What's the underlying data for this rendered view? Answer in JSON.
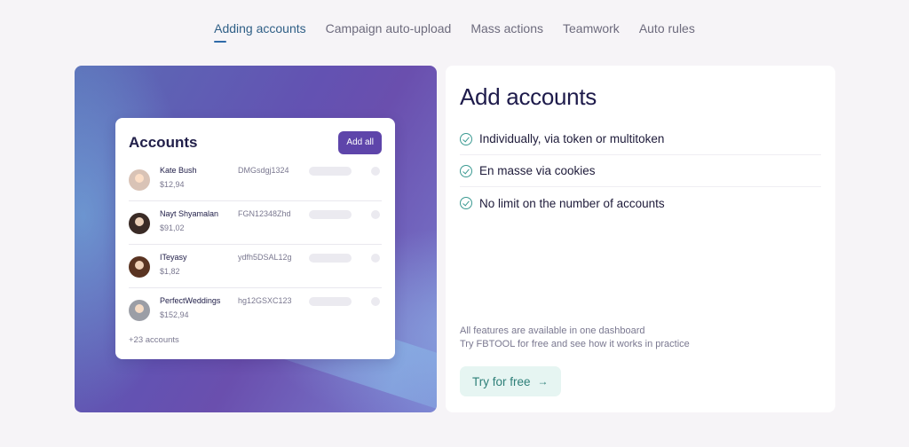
{
  "tabs": [
    {
      "label": "Adding accounts",
      "active": true
    },
    {
      "label": "Campaign auto-upload",
      "active": false
    },
    {
      "label": "Mass actions",
      "active": false
    },
    {
      "label": "Teamwork",
      "active": false
    },
    {
      "label": "Auto rules",
      "active": false
    }
  ],
  "accounts_card": {
    "title": "Accounts",
    "add_all_label": "Add all",
    "rows": [
      {
        "name": "Kate Bush",
        "balance": "$12,94",
        "id": "DMGsdgj1324",
        "avatar_color": "#d9c3b6"
      },
      {
        "name": "Nayt Shyamalan",
        "balance": "$91,02",
        "id": "FGN12348Zhd",
        "avatar_color": "#3a2b26"
      },
      {
        "name": "ITeyasy",
        "balance": "$1,82",
        "id": "ydfh5DSAL12g",
        "avatar_color": "#5a3422"
      },
      {
        "name": "PerfectWeddings",
        "balance": "$152,94",
        "id": "hg12GSXC123",
        "avatar_color": "#9b9ea6"
      }
    ],
    "more_label": "+23 accounts"
  },
  "info_card": {
    "title": "Add accounts",
    "features": [
      "Individually, via token or multitoken",
      "En masse via cookies",
      "No limit on the number of accounts"
    ],
    "footer_line1": "All features are available in one dashboard",
    "footer_line2": "Try FBTOOL for free and see how it works in practice",
    "cta_label": "Try for free",
    "cta_arrow": "→"
  },
  "colors": {
    "accent_purple": "#5e45aa",
    "accent_teal": "#3b9a92",
    "active_tab": "#2f5f86"
  }
}
